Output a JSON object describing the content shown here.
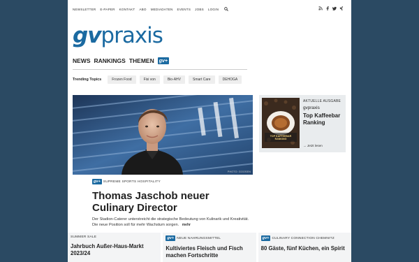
{
  "topnav": {
    "items": [
      "NEWSLETTER",
      "E-PAPER",
      "KONTAKT",
      "ABO",
      "MEDIADATEN",
      "EVENTS",
      "JOBS",
      "LOGIN"
    ]
  },
  "icons": {
    "search": "search-icon",
    "social": [
      "rss-icon",
      "facebook-icon",
      "twitter-icon",
      "xing-icon"
    ]
  },
  "logo": {
    "bold": "gv",
    "rest": "praxis"
  },
  "mainnav": {
    "items": [
      "NEWS",
      "RANKINGS",
      "THEMEN"
    ],
    "plus_badge": "gv+"
  },
  "trending": {
    "label": "Trending Topics",
    "chips": [
      "Frozen Food",
      "Fisi von",
      "Bio-AHV",
      "Smart Care",
      "DEHOGA"
    ]
  },
  "hero": {
    "credit": "PHOTO: GOOSEN"
  },
  "issue": {
    "label": "AKTUELLE AUSGABE",
    "publication": "gvpraxis",
    "title": "Top Kaffeebar Ranking",
    "cover_title": "TOP KAFFEEBAR RANKING",
    "read_link": "→ Jetzt lesen"
  },
  "article": {
    "badge": "gv+",
    "kicker": "SUPREME SPORTS HOSPITALITY",
    "headline": "Thomas Jaschob neuer Culinary Director",
    "teaser": "Der Stadion-Caterer unterstreicht die strategische Bedeutung von Kulinarik und Kreativität. Die neue Position soll für mehr Wachstum sorgen.",
    "more": "mehr"
  },
  "cards": [
    {
      "badge": "",
      "kicker": "SUMMER SALE",
      "headline": "Jahrbuch Außer-Haus-Markt 2023/24"
    },
    {
      "badge": "gv+",
      "kicker": "NEUE NAHRUNGSMITTEL",
      "headline": "Kultiviertes Fleisch und Fisch machen Fortschritte"
    },
    {
      "badge": "gv+",
      "kicker": "CULINARY CONNECTION CHEMNITZ",
      "headline": "80 Gäste, fünf Küchen, ein Spirit"
    }
  ],
  "colors": {
    "brand": "#1b6aa1",
    "background": "#2b4a63"
  }
}
